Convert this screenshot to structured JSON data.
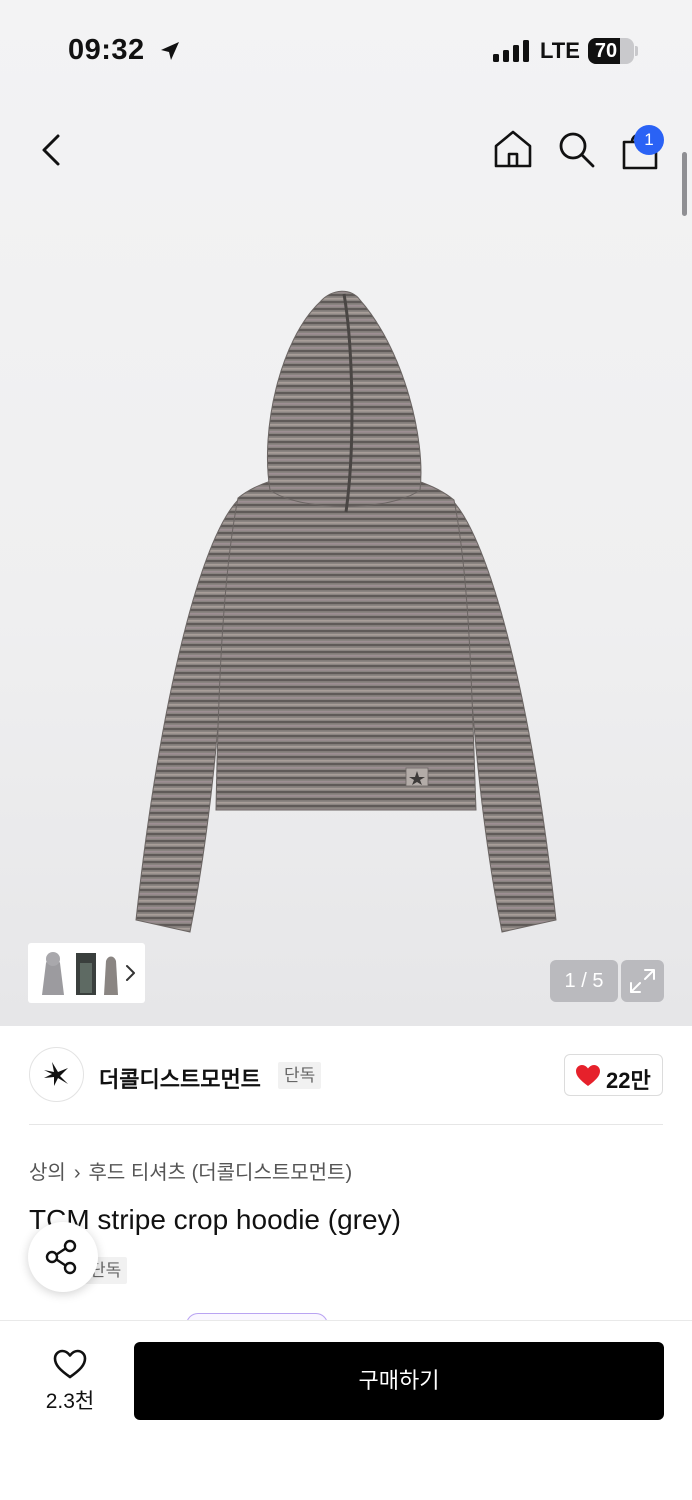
{
  "status_bar": {
    "time": "09:32",
    "network": "LTE",
    "battery": "70",
    "battery_level": 0.7
  },
  "nav": {
    "back_icon": "chevron-left-icon",
    "home_icon": "home-icon",
    "search_icon": "search-icon",
    "cart_icon": "shopping-bag-icon",
    "cart_badge": "1",
    "badge_color": "#2a62f5"
  },
  "gallery": {
    "counter": "1 / 5",
    "current": 1,
    "total": 5,
    "expand_icon": "expand-icon"
  },
  "brand": {
    "name": "더콜디스트모먼트",
    "tag": "단독",
    "likes": "22만",
    "heart_color": "#e6212b"
  },
  "product": {
    "breadcrumb": [
      "상의",
      "후드 티셔츠 (더콜디스트모먼트)"
    ],
    "title": "TCM stripe crop hoodie (grey)",
    "tag": "단독"
  },
  "bottom_bar": {
    "wish_count": "2.3천",
    "buy_label": "구매하기"
  }
}
